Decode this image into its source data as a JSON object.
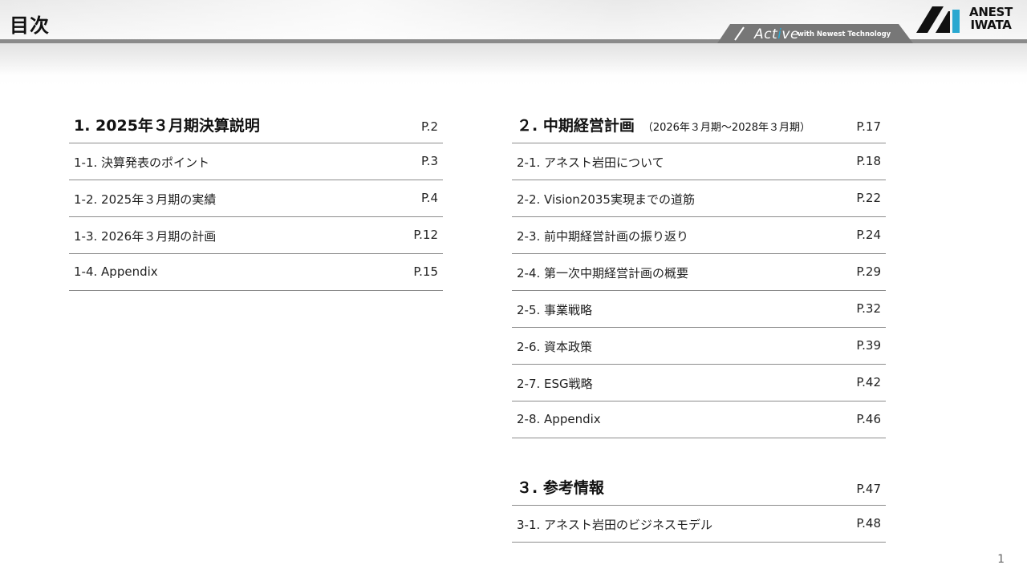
{
  "header": {
    "title": "目次",
    "badge": {
      "word_pre": "Act",
      "word_i": "i",
      "word_post": "ve",
      "tagline": "with Newest Technology"
    },
    "logo": {
      "line1": "ANEST",
      "line2": "IWATA"
    },
    "colors": {
      "bar": "#8a8a8a",
      "accent": "#2aa8d0"
    }
  },
  "sections": [
    {
      "title": "1. 2025年３月期決算説明",
      "subtitle": "",
      "page": "P.2",
      "items": [
        {
          "label": "1-1. 決算発表のポイント",
          "page": "P.3"
        },
        {
          "label": "1-2. 2025年３月期の実績",
          "page": "P.4"
        },
        {
          "label": "1-3. 2026年３月期の計画",
          "page": "P.12"
        },
        {
          "label": "1-4. Appendix",
          "page": "P.15"
        }
      ]
    },
    {
      "title": "２. 中期経営計画",
      "subtitle": "（2026年３月期～2028年３月期）",
      "page": "P.17",
      "items": [
        {
          "label": "2-1. アネスト岩田について",
          "page": "P.18"
        },
        {
          "label": "2-2. Vision2035実現までの道筋",
          "page": "P.22"
        },
        {
          "label": "2-3. 前中期経営計画の振り返り",
          "page": "P.24"
        },
        {
          "label": "2-4. 第一次中期経営計画の概要",
          "page": "P.29"
        },
        {
          "label": "2-5. 事業戦略",
          "page": "P.32"
        },
        {
          "label": "2-6. 資本政策",
          "page": "P.39"
        },
        {
          "label": "2-7. ESG戦略",
          "page": "P.42"
        },
        {
          "label": "2-8. Appendix",
          "page": "P.46"
        }
      ]
    },
    {
      "title": "３. 参考情報",
      "subtitle": "",
      "page": "P.47",
      "items": [
        {
          "label": "3-1. アネスト岩田のビジネスモデル",
          "page": "P.48"
        }
      ]
    }
  ],
  "footer": {
    "page_number": "1"
  }
}
